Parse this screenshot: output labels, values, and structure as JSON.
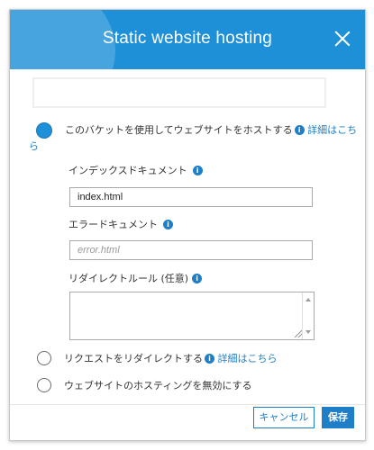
{
  "dialog": {
    "title": "Static website hosting",
    "top_box_value": ""
  },
  "options": {
    "host_site": {
      "label": "このバケットを使用してウェブサイトをホストする",
      "link_main": "詳細はこち",
      "link_tail": "ら",
      "selected": true
    },
    "redirect": {
      "label": "リクエストをリダイレクトする",
      "link": "詳細はこちら",
      "selected": false
    },
    "disable": {
      "label": "ウェブサイトのホスティングを無効にする",
      "selected": false
    }
  },
  "fields": {
    "index_doc": {
      "label": "インデックスドキュメント",
      "value": "index.html"
    },
    "error_doc": {
      "label": "エラードキュメント",
      "placeholder": "error.html"
    },
    "redirect_rules": {
      "label": "リダイレクトルール (任意)",
      "value": ""
    }
  },
  "info_icon_glyph": "i",
  "buttons": {
    "cancel": "キャンセル",
    "save": "保存"
  },
  "colors": {
    "header": "#1e90d8",
    "accent": "#1e7fc8"
  }
}
